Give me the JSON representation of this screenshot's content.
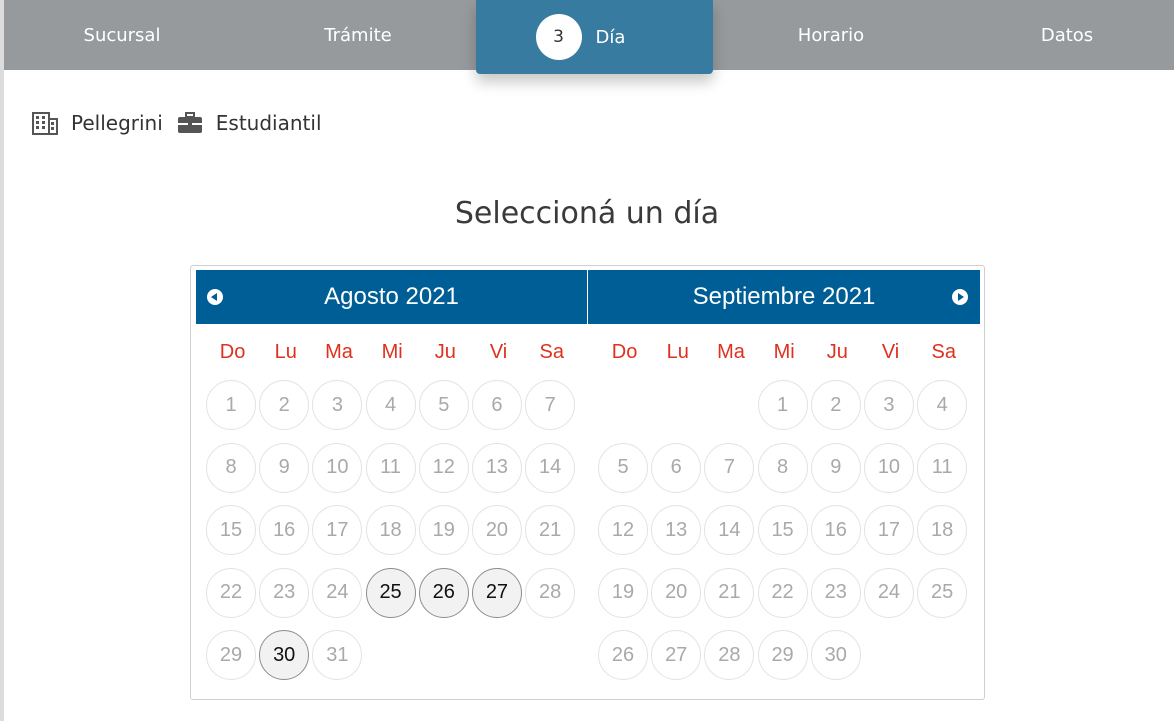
{
  "steps": [
    {
      "label": "Sucursal"
    },
    {
      "label": "Trámite"
    },
    {
      "label": "Día",
      "number": "3",
      "active": true
    },
    {
      "label": "Horario"
    },
    {
      "label": "Datos"
    }
  ],
  "selection": {
    "branch": "Pellegrini",
    "procedure": "Estudiantil"
  },
  "heading": "Seleccioná un día",
  "calendar": {
    "weekdays": [
      "Do",
      "Lu",
      "Ma",
      "Mi",
      "Ju",
      "Vi",
      "Sa"
    ],
    "months": [
      {
        "title": "Agosto 2021",
        "weeks": [
          [
            "1",
            "2",
            "3",
            "4",
            "5",
            "6",
            "7"
          ],
          [
            "8",
            "9",
            "10",
            "11",
            "12",
            "13",
            "14"
          ],
          [
            "15",
            "16",
            "17",
            "18",
            "19",
            "20",
            "21"
          ],
          [
            "22",
            "23",
            "24",
            "25",
            "26",
            "27",
            "28"
          ],
          [
            "29",
            "30",
            "31",
            "",
            "",
            "",
            ""
          ]
        ],
        "available": [
          "25",
          "26",
          "27",
          "30"
        ]
      },
      {
        "title": "Septiembre 2021",
        "weeks": [
          [
            "",
            "",
            "",
            "1",
            "2",
            "3",
            "4"
          ],
          [
            "5",
            "6",
            "7",
            "8",
            "9",
            "10",
            "11"
          ],
          [
            "12",
            "13",
            "14",
            "15",
            "16",
            "17",
            "18"
          ],
          [
            "19",
            "20",
            "21",
            "22",
            "23",
            "24",
            "25"
          ],
          [
            "26",
            "27",
            "28",
            "29",
            "30",
            "",
            ""
          ]
        ],
        "available": []
      }
    ]
  },
  "colors": {
    "stepper_bg": "#979a9d",
    "active_step": "#377ca0",
    "calendar_header": "#005e96",
    "weekday_text": "#e0301e"
  },
  "icons": {
    "branch": "building-icon",
    "procedure": "briefcase-icon",
    "prev": "chevron-left-icon",
    "next": "chevron-right-icon"
  }
}
